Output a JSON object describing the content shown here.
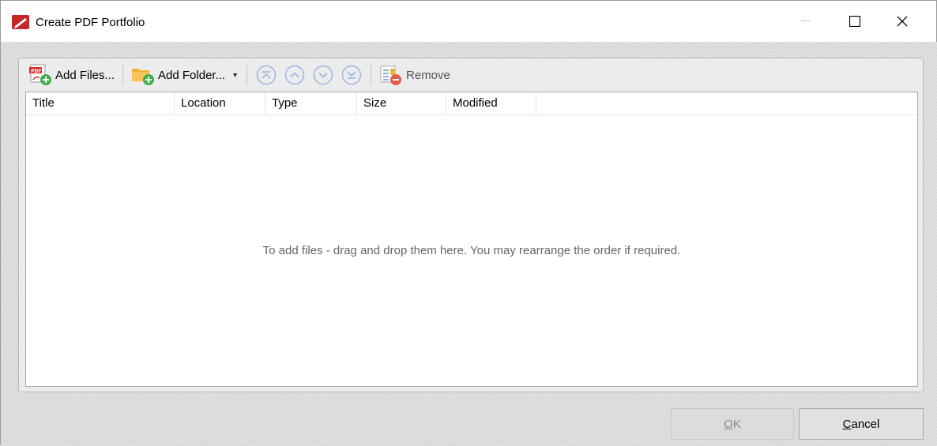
{
  "window": {
    "title": "Create PDF Portfolio"
  },
  "toolbar": {
    "add_files": "Add Files...",
    "add_folder": "Add Folder...",
    "remove": "Remove"
  },
  "columns": [
    "Title",
    "Location",
    "Type",
    "Size",
    "Modified"
  ],
  "list": {
    "empty_message": "To add files - drag and drop them here. You may rearrange the order if required."
  },
  "buttons": {
    "ok_mnemonic": "O",
    "ok_rest": "K",
    "cancel_mnemonic": "C",
    "cancel_rest": "ancel"
  },
  "colors": {
    "accent": "#5a8ad8",
    "pdf_red": "#d32f2f",
    "folder": "#f2b23a",
    "add_green": "#3fae49"
  }
}
